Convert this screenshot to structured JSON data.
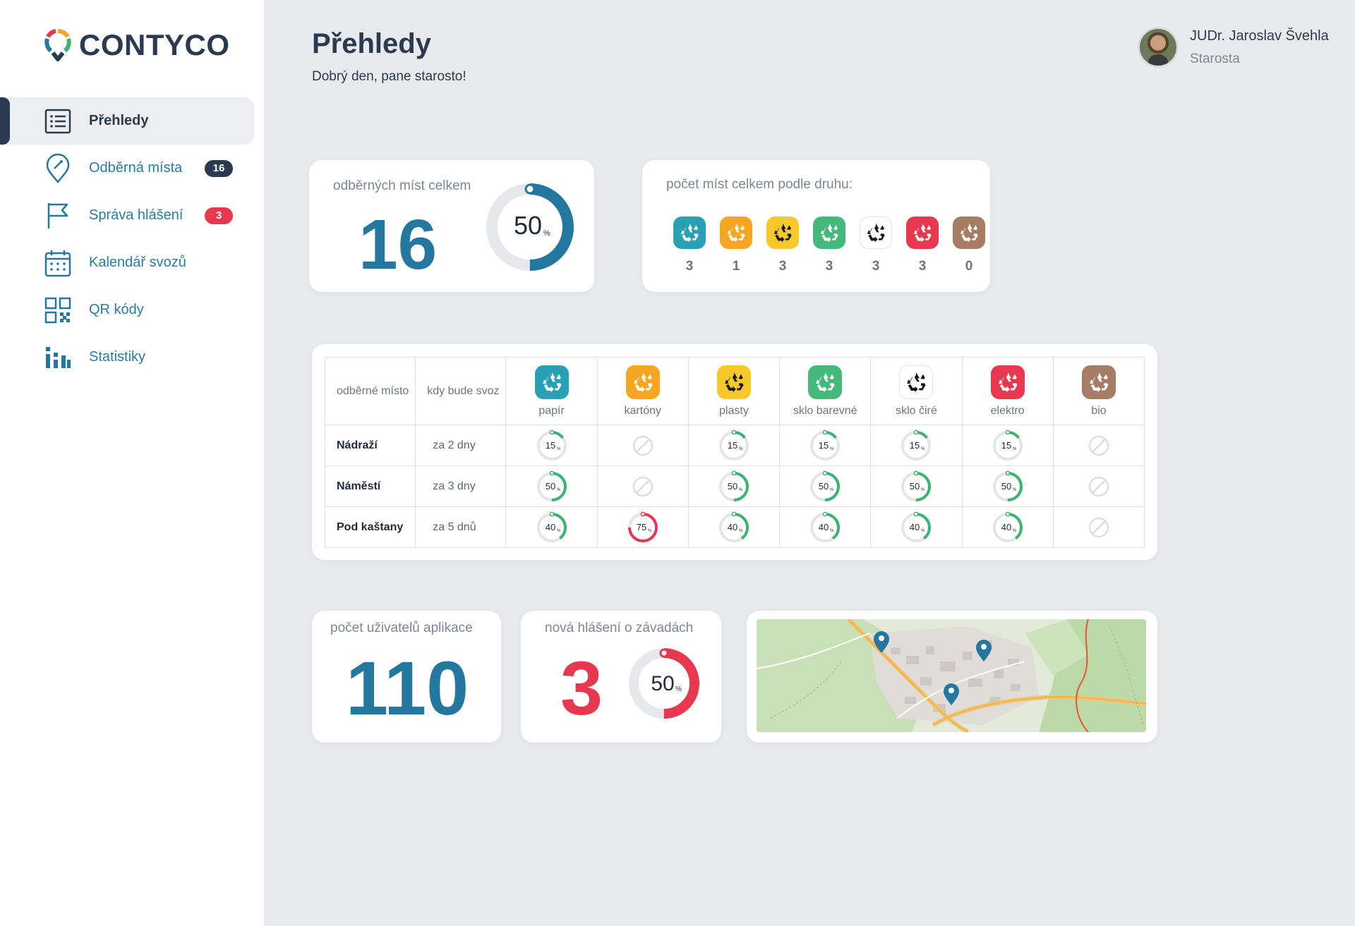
{
  "brand": {
    "name": "CONTYCO"
  },
  "sidebar": {
    "items": [
      {
        "label": "Přehledy",
        "icon": "list-icon",
        "active": true
      },
      {
        "label": "Odběrná místa",
        "icon": "map-pin-icon",
        "badge": "16"
      },
      {
        "label": "Správa hlášení",
        "icon": "flag-icon",
        "badge": "3"
      },
      {
        "label": "Kalendář svozů",
        "icon": "calendar-icon"
      },
      {
        "label": "QR kódy",
        "icon": "qr-code-icon"
      },
      {
        "label": "Statistiky",
        "icon": "bar-stats-icon"
      }
    ]
  },
  "header": {
    "title": "Přehledy",
    "subtitle": "Dobrý den, pane starosto!"
  },
  "user": {
    "name": "JUDr. Jaroslav Švehla",
    "role": "Starosta"
  },
  "colors": {
    "primary": "#2478a0",
    "dark": "#2a3b4f",
    "danger": "#e8384f",
    "ok": "#3cb371",
    "papir": "#2aa0b4",
    "kartony": "#f5a623",
    "plasty": "#f7c92c",
    "sklo_barevne": "#45b97c",
    "sklo_cire": "#ffffff",
    "elektro": "#e8384f",
    "bio": "#a67c64"
  },
  "summary": {
    "total_label": "odběrných míst celkem",
    "total_value": "16",
    "total_percent": 50,
    "total_percent_text": "50",
    "by_type_label": "počet míst celkem podle druhu:",
    "by_type": [
      {
        "key": "papir",
        "count": "3"
      },
      {
        "key": "kartony",
        "count": "1"
      },
      {
        "key": "plasty",
        "count": "3"
      },
      {
        "key": "sklo_barevne",
        "count": "3"
      },
      {
        "key": "sklo_cire",
        "count": "3"
      },
      {
        "key": "elektro",
        "count": "3"
      },
      {
        "key": "bio",
        "count": "0"
      }
    ]
  },
  "table": {
    "col_place": "odběrné místo",
    "col_when": "kdy bude svoz",
    "types": [
      {
        "key": "papir",
        "label": "papír"
      },
      {
        "key": "kartony",
        "label": "kartóny"
      },
      {
        "key": "plasty",
        "label": "plasty"
      },
      {
        "key": "sklo_barevne",
        "label": "sklo barevné"
      },
      {
        "key": "sklo_cire",
        "label": "sklo čiré"
      },
      {
        "key": "elektro",
        "label": "elektro"
      },
      {
        "key": "bio",
        "label": "bio"
      }
    ],
    "rows": [
      {
        "place": "Nádraží",
        "when": "za 2 dny",
        "fills": [
          15,
          null,
          15,
          15,
          15,
          15,
          null
        ]
      },
      {
        "place": "Náměstí",
        "when": "za 3 dny",
        "fills": [
          50,
          null,
          50,
          50,
          50,
          50,
          null
        ]
      },
      {
        "place": "Pod kaštany",
        "when": "za 5 dnů",
        "fills": [
          40,
          75,
          40,
          40,
          40,
          40,
          null
        ]
      }
    ]
  },
  "bottom": {
    "users_label": "počet uživatelů aplikace",
    "users_value": "110",
    "reports_label": "nová hlášení o závadách",
    "reports_value": "3",
    "reports_percent": 50,
    "reports_percent_text": "50"
  }
}
